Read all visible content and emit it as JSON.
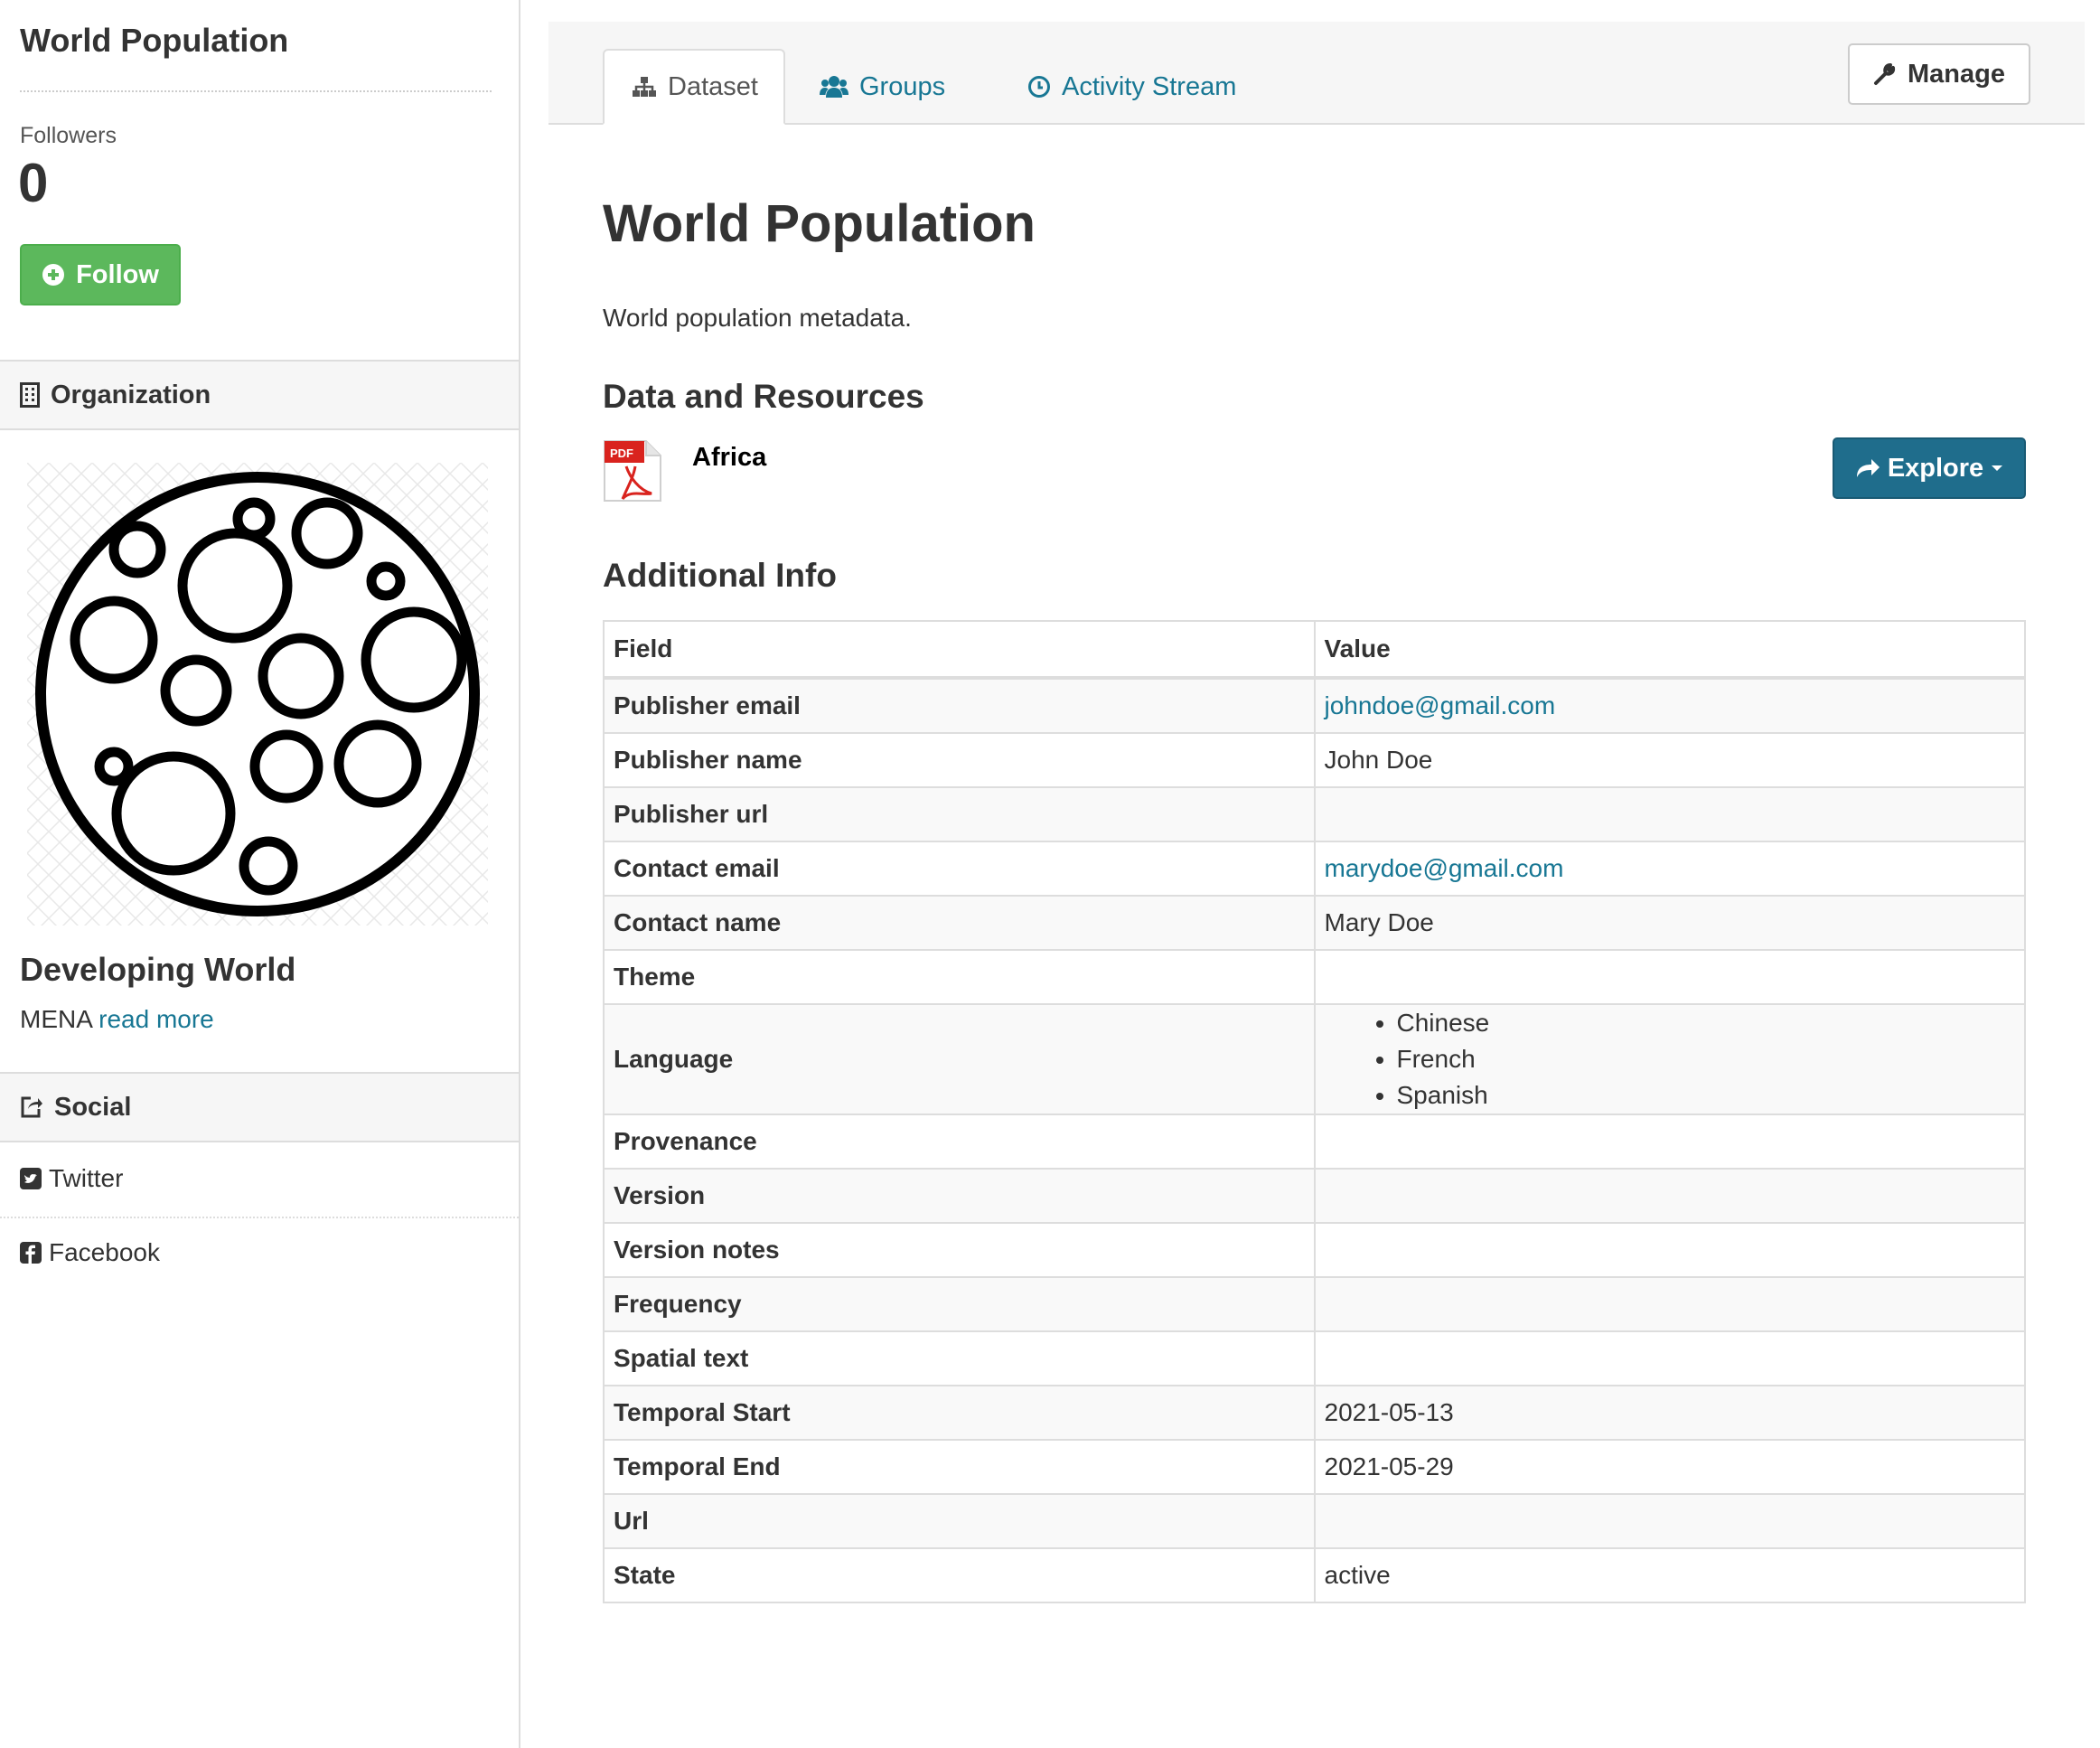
{
  "sidebar": {
    "title": "World Population",
    "followers_label": "Followers",
    "followers_count": "0",
    "follow_label": "Follow",
    "organization_heading": "Organization",
    "org_name": "Developing World",
    "org_desc": "MENA",
    "org_read_more": "read more",
    "social_heading": "Social",
    "social_links": [
      "Twitter",
      "Facebook"
    ]
  },
  "header": {
    "tabs": [
      {
        "label": "Dataset",
        "icon": "sitemap-icon",
        "active": true
      },
      {
        "label": "Groups",
        "icon": "users-icon",
        "active": false
      },
      {
        "label": "Activity Stream",
        "icon": "clock-icon",
        "active": false
      }
    ],
    "manage_label": "Manage"
  },
  "main": {
    "title": "World Population",
    "description": "World population metadata.",
    "resources_heading": "Data and Resources",
    "resource": {
      "name": "Africa",
      "format": "PDF",
      "explore_label": "Explore"
    },
    "additional_heading": "Additional Info",
    "table": {
      "headers": [
        "Field",
        "Value"
      ],
      "rows": [
        {
          "field": "Publisher email",
          "value": "johndoe@gmail.com"
        },
        {
          "field": "Publisher name",
          "value": "John Doe"
        },
        {
          "field": "Publisher url",
          "value": ""
        },
        {
          "field": "Contact email",
          "value": "marydoe@gmail.com"
        },
        {
          "field": "Contact name",
          "value": "Mary Doe"
        },
        {
          "field": "Theme",
          "value": ""
        },
        {
          "field": "Language",
          "values": [
            "Chinese",
            "French",
            "Spanish"
          ]
        },
        {
          "field": "Provenance",
          "value": ""
        },
        {
          "field": "Version",
          "value": ""
        },
        {
          "field": "Version notes",
          "value": ""
        },
        {
          "field": "Frequency",
          "value": ""
        },
        {
          "field": "Spatial text",
          "value": ""
        },
        {
          "field": "Temporal Start",
          "value": "2021-05-13"
        },
        {
          "field": "Temporal End",
          "value": "2021-05-29"
        },
        {
          "field": "Url",
          "value": ""
        },
        {
          "field": "State",
          "value": "active"
        }
      ]
    }
  },
  "colors": {
    "follow_green": "#5cb85c",
    "explore_blue": "#1f6d8c",
    "link": "#187794",
    "pdf_red": "#d9231e"
  }
}
